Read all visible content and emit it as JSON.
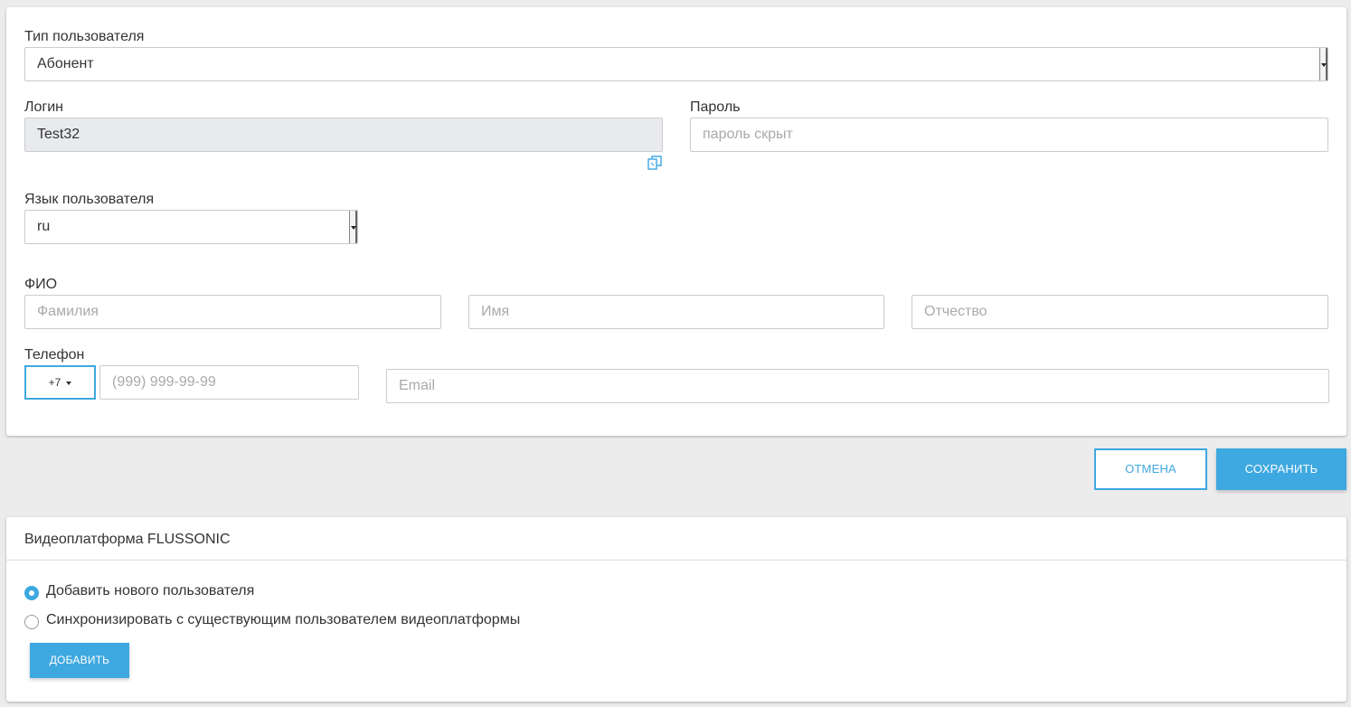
{
  "form": {
    "user_type": {
      "label": "Тип пользователя",
      "value": "Абонент"
    },
    "login": {
      "label": "Логин",
      "value": "Test32"
    },
    "password": {
      "label": "Пароль",
      "placeholder": "пароль скрыт"
    },
    "language": {
      "label": "Язык пользователя",
      "value": "ru"
    },
    "fio": {
      "label": "ФИО",
      "last_name_placeholder": "Фамилия",
      "first_name_placeholder": "Имя",
      "middle_name_placeholder": "Отчество"
    },
    "phone": {
      "label": "Телефон",
      "country_code": "+7",
      "placeholder": "(999) 999-99-99"
    },
    "email": {
      "placeholder": "Email"
    }
  },
  "actions": {
    "cancel_label": "ОТМЕНА",
    "save_label": "СОХРАНИТЬ"
  },
  "videoplatform": {
    "title": "Видеоплатформа FLUSSONIC",
    "options": [
      {
        "label": "Добавить нового пользователя",
        "checked": true
      },
      {
        "label": "Синхронизировать с существующим пользователем видеоплатформы",
        "checked": false
      }
    ],
    "add_label": "ДОБАВИТЬ"
  },
  "colors": {
    "accent": "#3ea8e0",
    "background": "#ececec",
    "disabled_field": "#e8eaed"
  },
  "icons": {
    "copy": "copy-icon",
    "select_arrow": "chevron-down-icon",
    "radio": "radio-icon"
  }
}
